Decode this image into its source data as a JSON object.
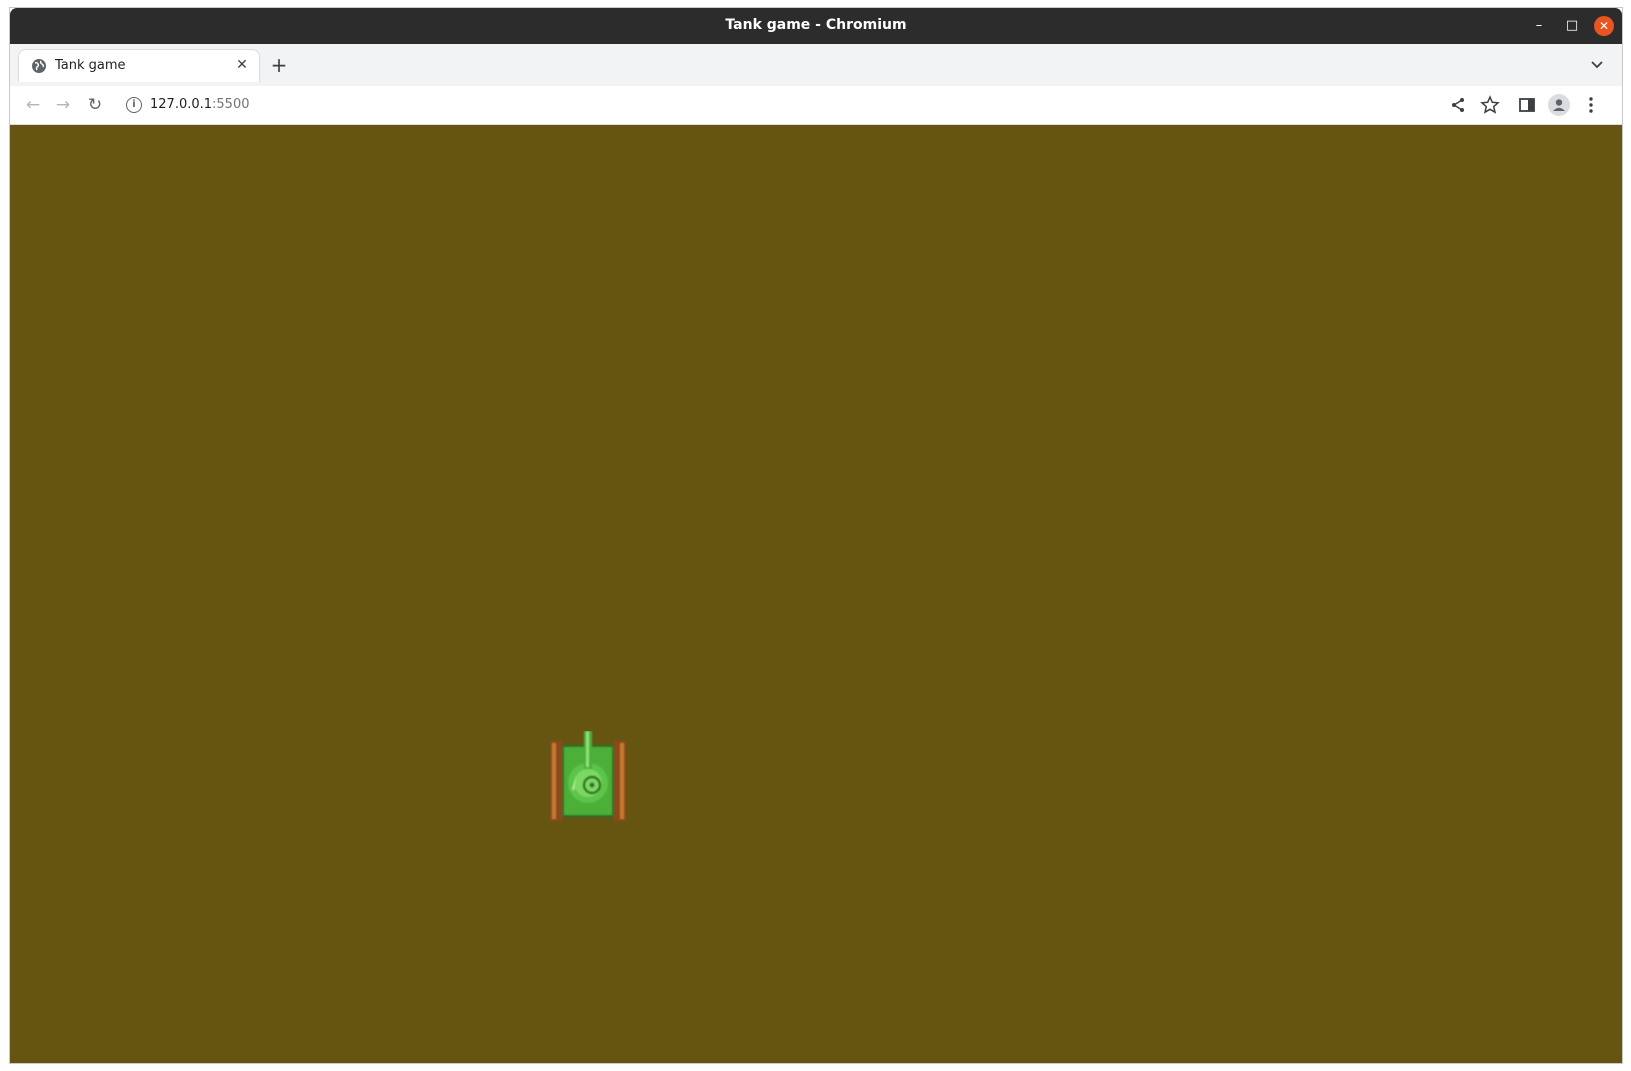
{
  "window": {
    "title": "Tank game - Chromium",
    "controls": {
      "minimize_glyph": "–",
      "maximize_glyph": "□",
      "close_glyph": "✕"
    }
  },
  "tabs": [
    {
      "label": "Tank game",
      "favicon": "globe-icon",
      "close_glyph": "✕",
      "active": true
    }
  ],
  "tabstrip": {
    "new_tab_glyph": "+",
    "tab_search_glyph": "⌄"
  },
  "toolbar": {
    "back_glyph": "←",
    "forward_glyph": "→",
    "reload_glyph": "↻",
    "info_glyph": "i",
    "url_host": "127.0.0.1",
    "url_port": ":5500",
    "icons": [
      "share-icon",
      "star-icon",
      "side-panel-icon",
      "profile-avatar-icon",
      "kebab-menu-icon"
    ]
  },
  "game": {
    "background_color": "#665411",
    "sprites": [
      {
        "kind": "player-tank",
        "facing": "up",
        "body_color": "#4caf38",
        "tread_color": "#8b4a1a"
      }
    ]
  },
  "colors": {
    "titlebar": "#2c2c2c",
    "close_button": "#e95420",
    "tabstrip": "#f1f3f4"
  }
}
